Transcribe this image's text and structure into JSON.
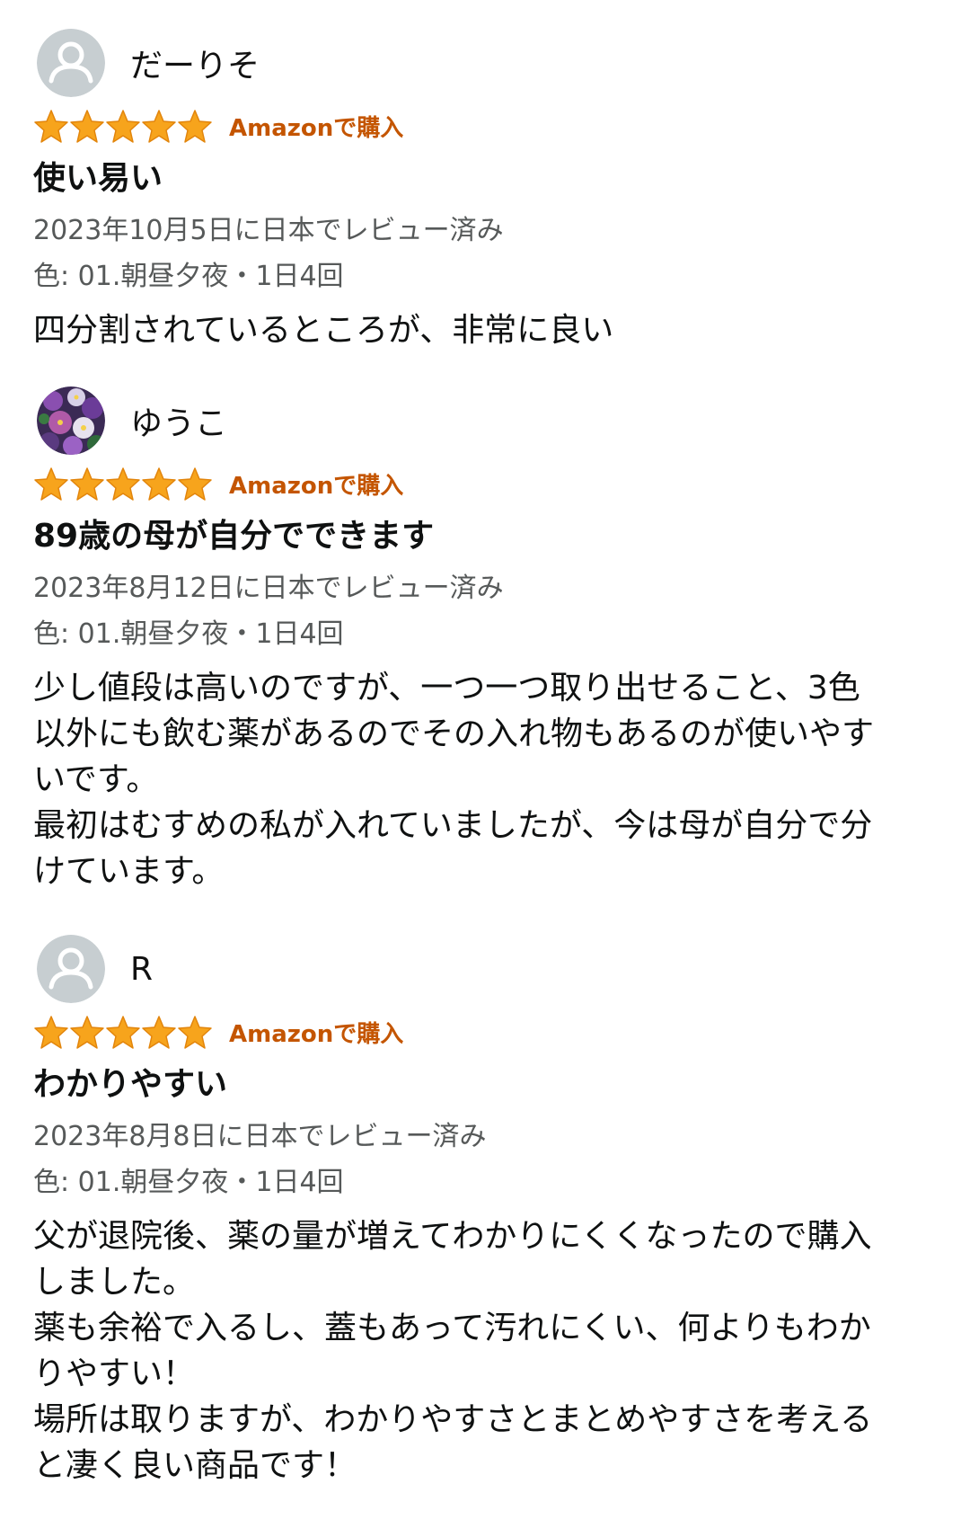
{
  "colors": {
    "star": "#f7a41c",
    "badge": "#c45500",
    "meta": "#565959",
    "avatar_bg": "#c7ced1"
  },
  "reviews": [
    {
      "reviewer": "だーりそ",
      "avatar": "default-person-icon",
      "rating": 5,
      "badge": "Amazonで購入",
      "title": "使い易い",
      "date": "2023年10月5日に日本でレビュー済み",
      "variant": "色: 01.朝昼夕夜・1日4回",
      "body": [
        "四分割されているところが、非常に良い"
      ]
    },
    {
      "reviewer": "ゆうこ",
      "avatar": "flower-photo-avatar",
      "rating": 5,
      "badge": "Amazonで購入",
      "title": "89歳の母が自分でできます",
      "date": "2023年8月12日に日本でレビュー済み",
      "variant": "色: 01.朝昼夕夜・1日4回",
      "body": [
        "少し値段は高いのですが、一つ一つ取り出せること、3色",
        "以外にも飲む薬があるのでその入れ物もあるのが使いやす",
        "いです。",
        "最初はむすめの私が入れていましたが、今は母が自分で分",
        "けています。"
      ]
    },
    {
      "reviewer": "R",
      "avatar": "default-person-icon",
      "rating": 5,
      "badge": "Amazonで購入",
      "title": "わかりやすい",
      "date": "2023年8月8日に日本でレビュー済み",
      "variant": "色: 01.朝昼夕夜・1日4回",
      "body": [
        "父が退院後、薬の量が増えてわかりにくくなったので購入",
        "しました。",
        "薬も余裕で入るし、蓋もあって汚れにくい、何よりもわか",
        "りやすい！",
        "場所は取りますが、わかりやすさとまとめやすさを考える",
        "と凄く良い商品です！"
      ]
    }
  ]
}
